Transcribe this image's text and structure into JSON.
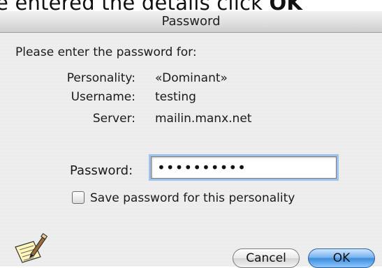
{
  "caption": {
    "text_lead": "e entered the details click ",
    "text_bold": "OK"
  },
  "dialog": {
    "title": "Password",
    "prompt": "Please enter the password for:",
    "info": [
      {
        "label": "Personality:",
        "value": "«Dominant»"
      },
      {
        "label": "Username:",
        "value": "testing"
      },
      {
        "label": "Server:",
        "value": "mailin.manx.net"
      }
    ],
    "password_label": "Password:",
    "password_value": "••••••••••",
    "save_checkbox_label": "Save password for this personality",
    "save_checked": false,
    "cancel_label": "Cancel",
    "ok_label": "OK",
    "icon": "pen-and-paper-icon",
    "colors": {
      "default_button": "#4a93de",
      "focus_ring": "#9fc2ea"
    }
  }
}
